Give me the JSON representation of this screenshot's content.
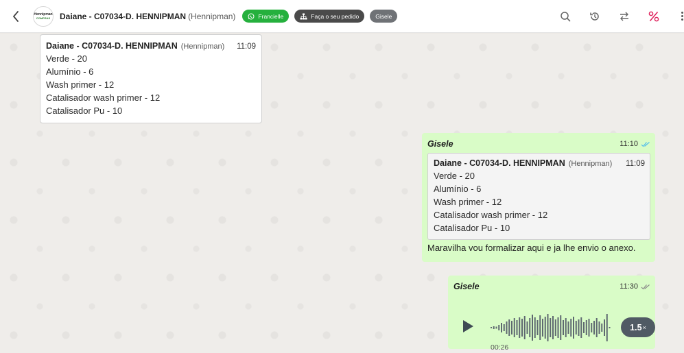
{
  "header": {
    "contact_name": "Daiane - C07034-D. HENNIPMAN",
    "contact_sub": "(Hennipman)",
    "avatar_line1": "Hennipman",
    "avatar_line2": "COMPRAS",
    "chip_agent": "Francielle",
    "chip_order": "Faça o seu pedido",
    "chip_user": "Gisele",
    "icons": [
      "back-arrow-icon",
      "whatsapp-icon",
      "sitemap-icon",
      "search-icon",
      "history-icon",
      "transfer-icon",
      "percent-icon",
      "more-icon"
    ],
    "colors": {
      "accent_green": "#25b03d",
      "danger": "#e0245e"
    }
  },
  "messages": {
    "incoming": {
      "quote_name": "Daiane - C07034-D. HENNIPMAN",
      "quote_sub": "(Hennipman)",
      "time": "11:09",
      "lines": [
        "Verde - 20",
        "Alumínio - 6",
        "Wash primer - 12",
        "Catalisador wash primer - 12",
        "Catalisador Pu - 10"
      ]
    },
    "outgoing_reply": {
      "sender": "Gisele",
      "time": "11:10",
      "quote_name": "Daiane - C07034-D. HENNIPMAN",
      "quote_sub": "(Hennipman)",
      "quote_time": "11:09",
      "quote_lines": [
        "Verde - 20",
        "Alumínio - 6",
        "Wash primer - 12",
        "Catalisador wash primer - 12",
        "Catalisador Pu - 10"
      ],
      "text": "Maravilha vou formalizar aqui e ja lhe envio o anexo."
    },
    "outgoing_audio": {
      "sender": "Gisele",
      "time": "11:30",
      "duration": "00:26",
      "speed": "1.5",
      "speed_suffix": "×"
    }
  },
  "colors": {
    "bubble_out": "#d9fcc7",
    "read_ticks": "#53bdeb"
  }
}
